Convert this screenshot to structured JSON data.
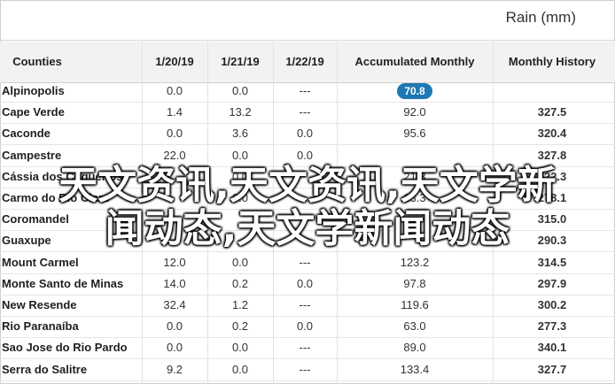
{
  "caption": "Rain (mm)",
  "columns": [
    "Counties",
    "1/20/19",
    "1/21/19",
    "1/22/19",
    "Accumulated Monthly",
    "Monthly History"
  ],
  "rows": [
    {
      "name": "Alpinopolis",
      "d1": "0.0",
      "d2": "0.0",
      "d3": "---",
      "acc": "70.8",
      "hist": ""
    },
    {
      "name": "Cape Verde",
      "d1": "1.4",
      "d2": "13.2",
      "d3": "---",
      "acc": "92.0",
      "hist": "327.5"
    },
    {
      "name": "Caconde",
      "d1": "0.0",
      "d2": "3.6",
      "d3": "0.0",
      "acc": "95.6",
      "hist": "320.4"
    },
    {
      "name": "Campestre",
      "d1": "22.0",
      "d2": "0.0",
      "d3": "0.0",
      "acc": "",
      "hist": "327.8"
    },
    {
      "name": "Cássia dos Coqueiros",
      "d1": "",
      "d2": "0.0",
      "d3": "",
      "acc": "21.3",
      "hist": "322.3"
    },
    {
      "name": "Carmo do Rio Claro",
      "d1": "",
      "d2": "0.0",
      "d3": "",
      "acc": "63.3",
      "hist": "278.1"
    },
    {
      "name": "Coromandel",
      "d1": "",
      "d2": "",
      "d3": "",
      "acc": "",
      "hist": "315.0"
    },
    {
      "name": "Guaxupe",
      "d1": "",
      "d2": "",
      "d3": "",
      "acc": "",
      "hist": "290.3"
    },
    {
      "name": "Mount Carmel",
      "d1": "12.0",
      "d2": "0.0",
      "d3": "---",
      "acc": "123.2",
      "hist": "314.5"
    },
    {
      "name": "Monte Santo de Minas",
      "d1": "14.0",
      "d2": "0.2",
      "d3": "0.0",
      "acc": "97.8",
      "hist": "297.9"
    },
    {
      "name": "New Resende",
      "d1": "32.4",
      "d2": "1.2",
      "d3": "---",
      "acc": "119.6",
      "hist": "300.2"
    },
    {
      "name": "Rio Paranaíba",
      "d1": "0.0",
      "d2": "0.2",
      "d3": "0.0",
      "acc": "63.0",
      "hist": "277.3"
    },
    {
      "name": "Sao Jose do Rio Pardo",
      "d1": "0.0",
      "d2": "0.0",
      "d3": "---",
      "acc": "89.0",
      "hist": "340.1"
    },
    {
      "name": "Serra do Salitre",
      "d1": "9.2",
      "d2": "0.0",
      "d3": "---",
      "acc": "133.4",
      "hist": "327.7"
    }
  ],
  "highlight_color": "#1f77b4",
  "watermark": [
    "天文资讯,天文资讯,天文学新",
    "闻动态,天文学新闻动态"
  ]
}
